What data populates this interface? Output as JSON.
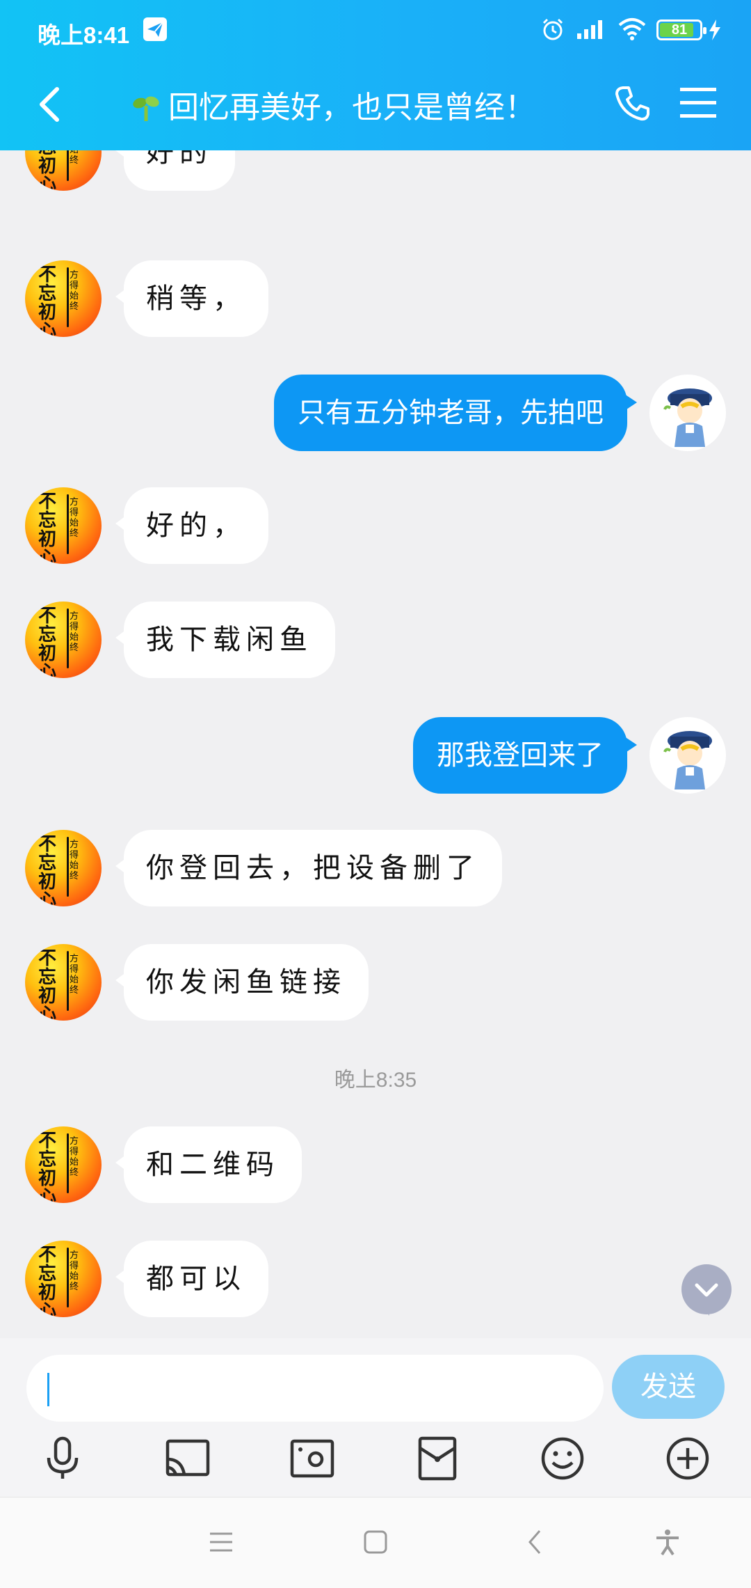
{
  "status_bar": {
    "time": "晚上8:41",
    "battery": "81"
  },
  "header": {
    "title": "回忆再美好，也只是曾经！"
  },
  "avatars": {
    "other_text_large": "不忘初心",
    "other_text_small": "方得始终"
  },
  "messages": [
    {
      "side": "in",
      "text": "好的"
    },
    {
      "side": "in",
      "text": "稍等，"
    },
    {
      "side": "out",
      "text": "只有五分钟老哥，先拍吧"
    },
    {
      "side": "in",
      "text": "好的，"
    },
    {
      "side": "in",
      "text": "我下载闲鱼"
    },
    {
      "side": "out",
      "text": "那我登回来了"
    },
    {
      "side": "in",
      "text": "你登回去，把设备删了"
    },
    {
      "side": "in",
      "text": "你发闲鱼链接"
    },
    {
      "side": "in",
      "text": "和二维码"
    },
    {
      "side": "in",
      "text": "都可以"
    }
  ],
  "timestamp": "晚上8:35",
  "input": {
    "send_label": "发送"
  },
  "colors": {
    "header_gradient_start": "#12c3f5",
    "header_gradient_end": "#1aa4f5",
    "outgoing_bubble": "#0d97f4",
    "send_button_disabled": "#8ed0f6"
  }
}
